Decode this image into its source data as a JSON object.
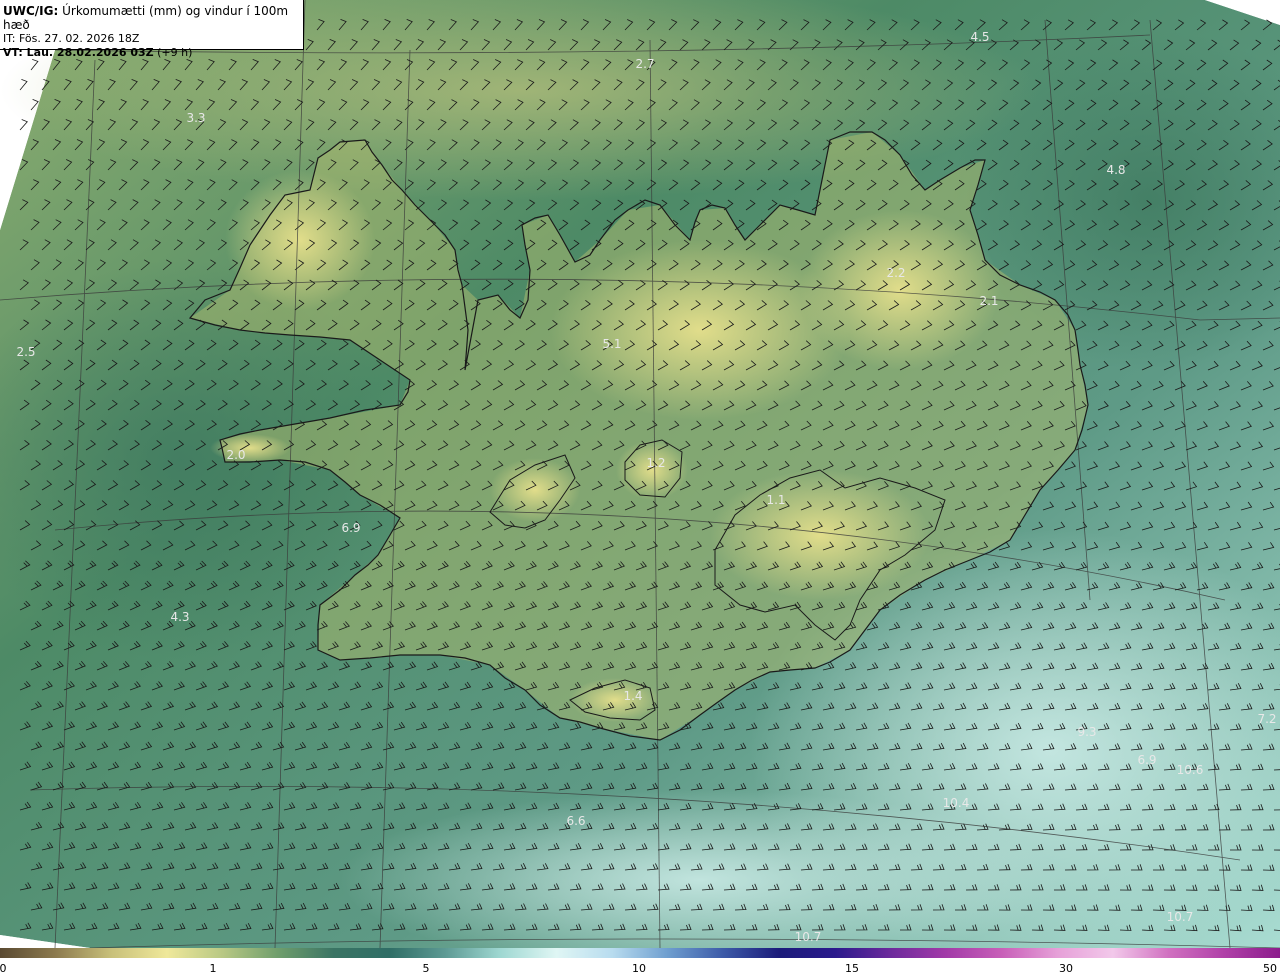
{
  "header": {
    "product": "UWC/IG:",
    "variable": "Úrkomumætti (mm) og vindur í 100m hæð",
    "issue_time": "IT: Fös. 27. 02. 2026 18Z",
    "valid_label": "VT: Lau. 28.02.2026 03Z",
    "valid_offset": "(+9 h)"
  },
  "map_values": [
    {
      "text": "4.5",
      "pos": [
        980,
        37
      ]
    },
    {
      "text": "2.7",
      "pos": [
        645,
        64
      ]
    },
    {
      "text": "3.3",
      "pos": [
        196,
        118
      ]
    },
    {
      "text": "4.8",
      "pos": [
        1116,
        170
      ]
    },
    {
      "text": "2.2",
      "pos": [
        896,
        273
      ]
    },
    {
      "text": "2.1",
      "pos": [
        989,
        301
      ]
    },
    {
      "text": "2.5",
      "pos": [
        26,
        352
      ]
    },
    {
      "text": "5.1",
      "pos": [
        612,
        344
      ]
    },
    {
      "text": "2.0",
      "pos": [
        236,
        455
      ]
    },
    {
      "text": "1.2",
      "pos": [
        656,
        463
      ]
    },
    {
      "text": "1.1",
      "pos": [
        776,
        500
      ]
    },
    {
      "text": "6.9",
      "pos": [
        351,
        528
      ]
    },
    {
      "text": "4.3",
      "pos": [
        180,
        617
      ]
    },
    {
      "text": "1.4",
      "pos": [
        633,
        696
      ]
    },
    {
      "text": "7.2",
      "pos": [
        1267,
        719
      ]
    },
    {
      "text": "9.3",
      "pos": [
        1087,
        732
      ]
    },
    {
      "text": "6.9",
      "pos": [
        1147,
        760
      ]
    },
    {
      "text": "10.6",
      "pos": [
        1190,
        770
      ]
    },
    {
      "text": "10.4",
      "pos": [
        956,
        803
      ]
    },
    {
      "text": "6.6",
      "pos": [
        576,
        821
      ]
    },
    {
      "text": "10.7",
      "pos": [
        808,
        937
      ]
    },
    {
      "text": "10.7",
      "pos": [
        1180,
        917
      ]
    }
  ],
  "colorbar": {
    "ticks": [
      "0",
      "1",
      "5",
      "10",
      "15",
      "30",
      "50"
    ],
    "colors": [
      "#5a4a32",
      "#8c7a4e",
      "#c8c07a",
      "#efe89a",
      "#b8c884",
      "#6f9e6c",
      "#3a7464",
      "#2f6e66",
      "#5d9a94",
      "#9fd8d2",
      "#dff6f4",
      "#b8dcef",
      "#6e9ecf",
      "#3c5aa8",
      "#1b1b7a",
      "#2a1a8c",
      "#6c2a9c",
      "#a23aa8",
      "#c85fb8",
      "#e6a0d8",
      "#f2c8ea",
      "#d070c0",
      "#b040a8",
      "#8c1c8c"
    ]
  },
  "colors": {
    "coastline": "#1a1a1a",
    "grid": "#3a3a3a",
    "barb": "#1a1a1a",
    "value_label": "#e8e8e8"
  }
}
